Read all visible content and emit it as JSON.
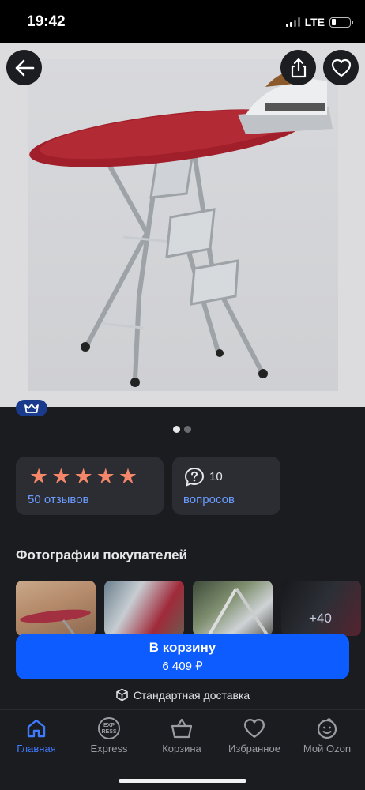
{
  "status_bar": {
    "time": "19:42",
    "network": "LTE",
    "battery_level": 0.15
  },
  "gallery": {
    "image_description_icon": "ironing-board-product-photo",
    "current_index": 1,
    "total": 2
  },
  "badge": {
    "icon": "crown-icon"
  },
  "rating": {
    "stars": 5,
    "reviews_label": "50 отзывов"
  },
  "questions": {
    "count": "10",
    "label": "вопросов"
  },
  "customer_photos": {
    "title": "Фотографии покупателей",
    "more_count": "+40"
  },
  "cart": {
    "label": "В корзину",
    "price": "6 409 ₽"
  },
  "delivery": {
    "label": "Стандартная доставка"
  },
  "nav": {
    "items": [
      {
        "label": "Главная",
        "icon": "home-icon",
        "active": true
      },
      {
        "label": "Express",
        "icon": "express-icon",
        "active": false
      },
      {
        "label": "Корзина",
        "icon": "basket-icon",
        "active": false
      },
      {
        "label": "Избранное",
        "icon": "heart-icon",
        "active": false
      },
      {
        "label": "Мой Ozon",
        "icon": "smile-icon",
        "active": false
      }
    ]
  },
  "colors": {
    "accent": "#0d5cff",
    "link": "#6b9cff",
    "star": "#f4866a",
    "background": "#1b1c20",
    "card": "#2c2d33"
  }
}
